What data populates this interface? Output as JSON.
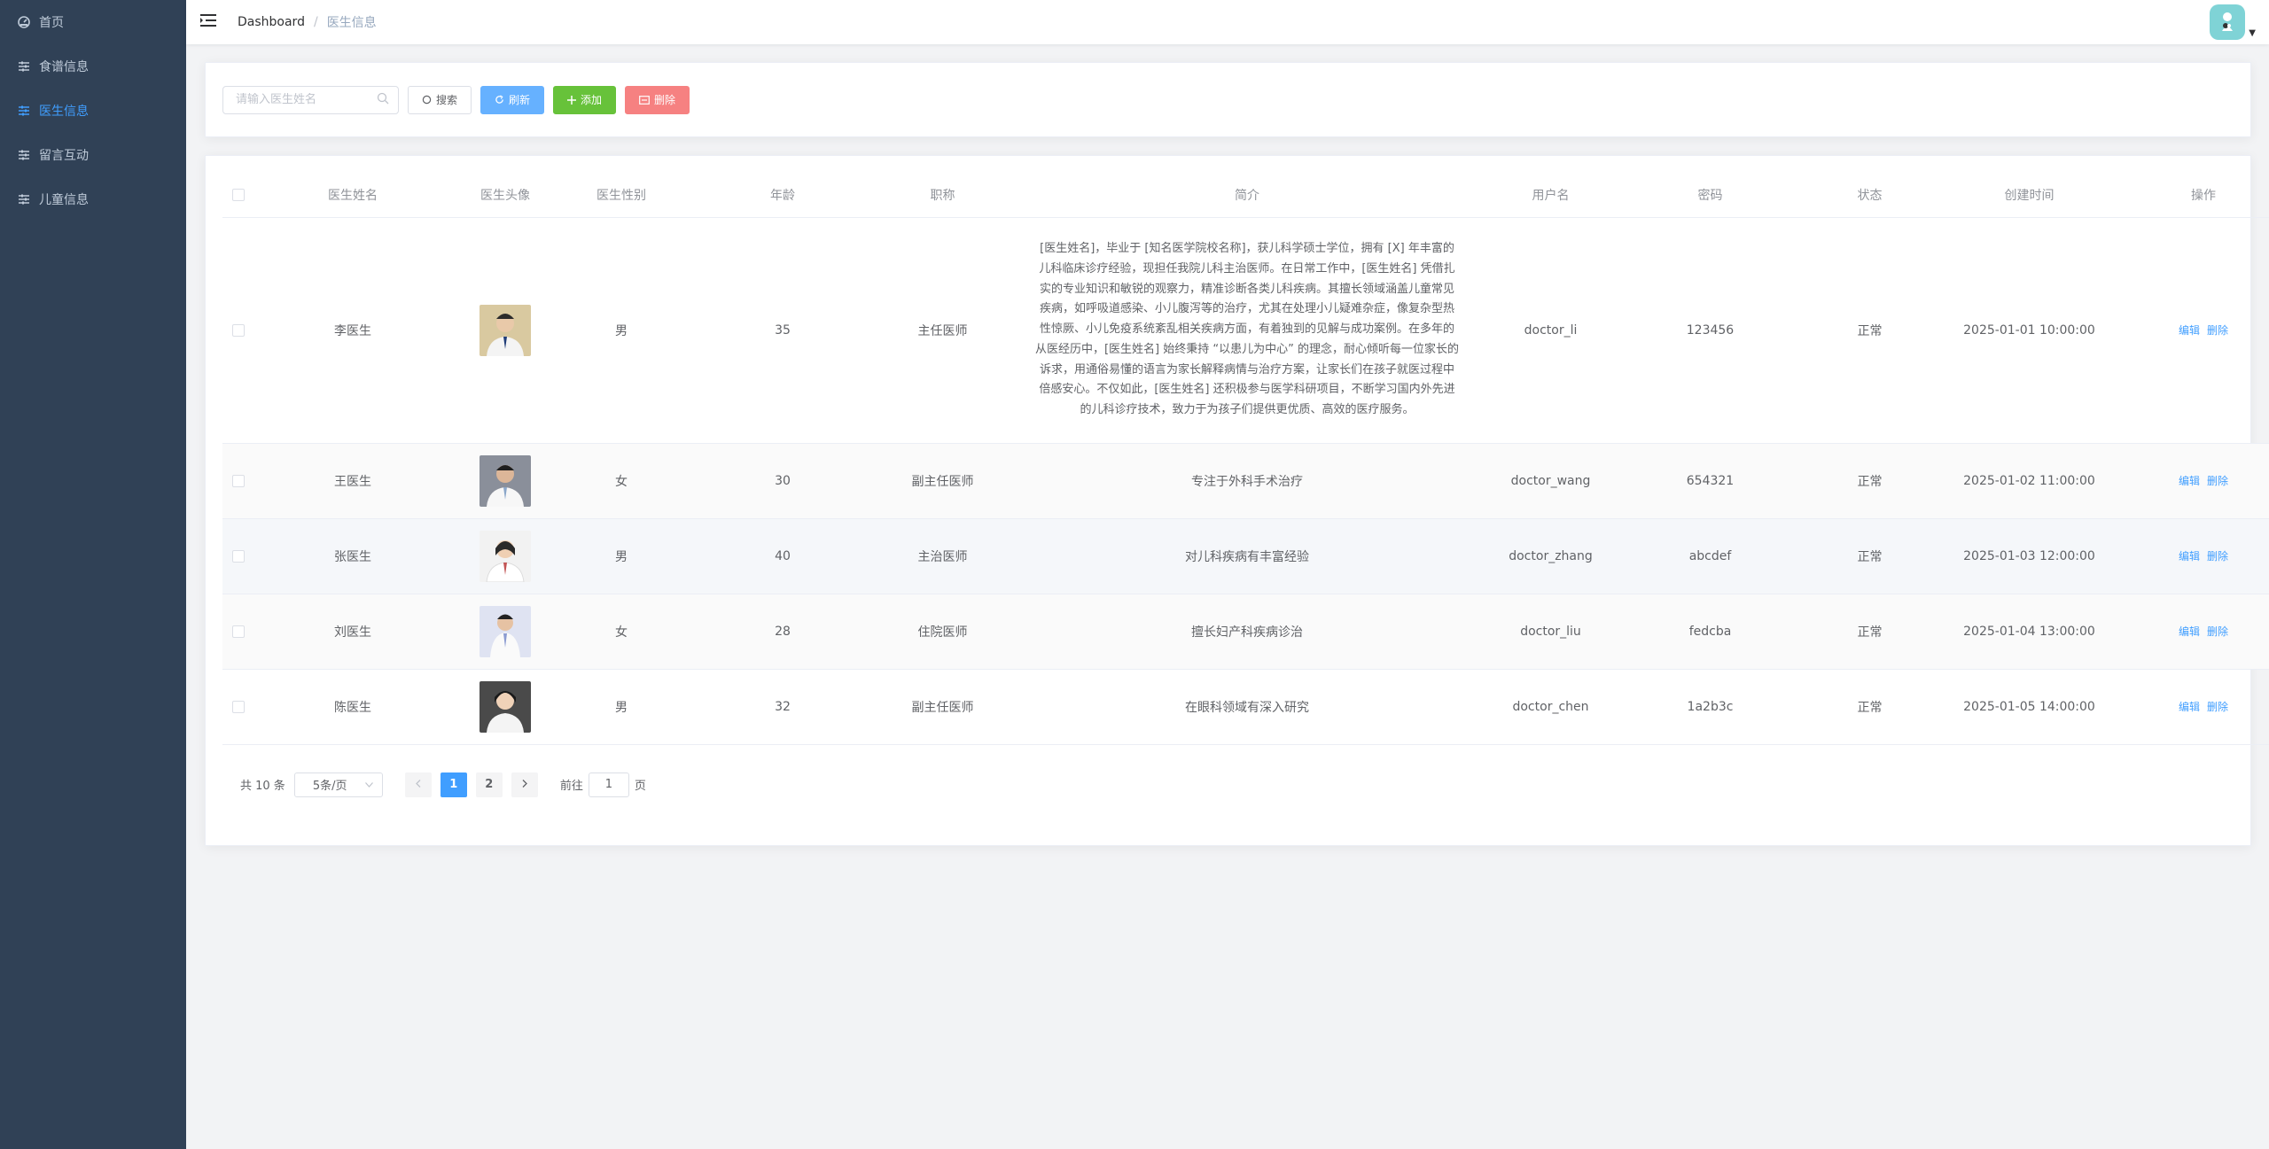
{
  "sidebar": {
    "items": [
      {
        "label": "首页",
        "icon": "dashboard-icon",
        "active": false
      },
      {
        "label": "食谱信息",
        "icon": "sliders-icon",
        "active": false
      },
      {
        "label": "医生信息",
        "icon": "sliders-icon",
        "active": true
      },
      {
        "label": "留言互动",
        "icon": "sliders-icon",
        "active": false
      },
      {
        "label": "儿童信息",
        "icon": "sliders-icon",
        "active": false
      }
    ]
  },
  "header": {
    "breadcrumb": {
      "home": "Dashboard",
      "separator": "/",
      "current": "医生信息"
    }
  },
  "toolbar": {
    "search_placeholder": "请输入医生姓名",
    "search_label": "搜索",
    "refresh_label": "刷新",
    "add_label": "添加",
    "delete_label": "删除"
  },
  "table": {
    "headers": {
      "name": "医生姓名",
      "avatar": "医生头像",
      "gender": "医生性别",
      "age": "年龄",
      "title": "职称",
      "intro": "简介",
      "username": "用户名",
      "password": "密码",
      "status": "状态",
      "created": "创建时间",
      "actions": "操作"
    },
    "edit_label": "编辑",
    "delete_label": "删除",
    "rows": [
      {
        "name": "李医生",
        "gender": "男",
        "age": "35",
        "title": "主任医师",
        "intro": "[医生姓名]，毕业于 [知名医学院校名称]，获儿科学硕士学位，拥有 [X] 年丰富的儿科临床诊疗经验，现担任我院儿科主治医师。在日常工作中，[医生姓名] 凭借扎实的专业知识和敏锐的观察力，精准诊断各类儿科疾病。其擅长领域涵盖儿童常见疾病，如呼吸道感染、小儿腹泻等的治疗，尤其在处理小儿疑难杂症，像复杂型热性惊厥、小儿免疫系统紊乱相关疾病方面，有着独到的见解与成功案例。在多年的从医经历中，[医生姓名] 始终秉持 “以患儿为中心” 的理念，耐心倾听每一位家长的诉求，用通俗易懂的语言为家长解释病情与治疗方案，让家长们在孩子就医过程中倍感安心。不仅如此，[医生姓名] 还积极参与医学科研项目，不断学习国内外先进的儿科诊疗技术，致力于为孩子们提供更优质、高效的医疗服务。",
        "username": "doctor_li",
        "password": "123456",
        "status": "正常",
        "created": "2025-01-01 10:00:00"
      },
      {
        "name": "王医生",
        "gender": "女",
        "age": "30",
        "title": "副主任医师",
        "intro": "专注于外科手术治疗",
        "username": "doctor_wang",
        "password": "654321",
        "status": "正常",
        "created": "2025-01-02 11:00:00"
      },
      {
        "name": "张医生",
        "gender": "男",
        "age": "40",
        "title": "主治医师",
        "intro": "对儿科疾病有丰富经验",
        "username": "doctor_zhang",
        "password": "abcdef",
        "status": "正常",
        "created": "2025-01-03 12:00:00"
      },
      {
        "name": "刘医生",
        "gender": "女",
        "age": "28",
        "title": "住院医师",
        "intro": "擅长妇产科疾病诊治",
        "username": "doctor_liu",
        "password": "fedcba",
        "status": "正常",
        "created": "2025-01-04 13:00:00"
      },
      {
        "name": "陈医生",
        "gender": "男",
        "age": "32",
        "title": "副主任医师",
        "intro": "在眼科领域有深入研究",
        "username": "doctor_chen",
        "password": "1a2b3c",
        "status": "正常",
        "created": "2025-01-05 14:00:00"
      }
    ]
  },
  "pagination": {
    "total": "共 10 条",
    "page_size": "5条/页",
    "pages": [
      "1",
      "2"
    ],
    "current_page": "1",
    "goto_prefix": "前往",
    "goto_value": "1",
    "goto_suffix": "页"
  }
}
